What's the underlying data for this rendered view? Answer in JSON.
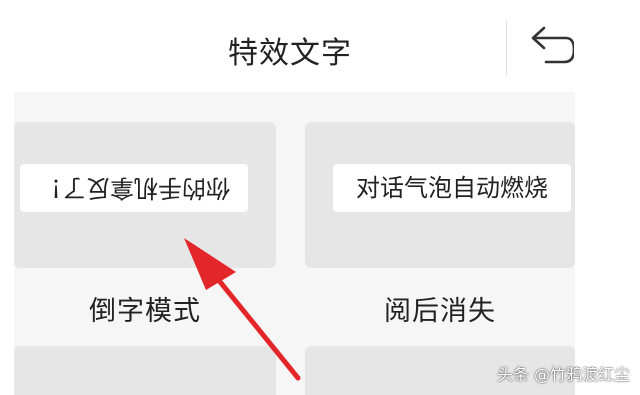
{
  "header": {
    "title": "特效文字",
    "back_icon": "undo-arrow-icon"
  },
  "cards": [
    {
      "preview": "你的手机拿反了！",
      "preview_orientation": "upside-down",
      "label": "倒字模式"
    },
    {
      "preview": "对话气泡自动燃烧",
      "preview_orientation": "normal",
      "label": "阅后消失"
    }
  ],
  "annotation": {
    "arrow_color": "#e3262a"
  },
  "watermark": "头条 @竹鸦渡红尘",
  "colors": {
    "card_bg": "#e6e6e6",
    "content_bg": "#f6f6f6",
    "text": "#222222"
  }
}
